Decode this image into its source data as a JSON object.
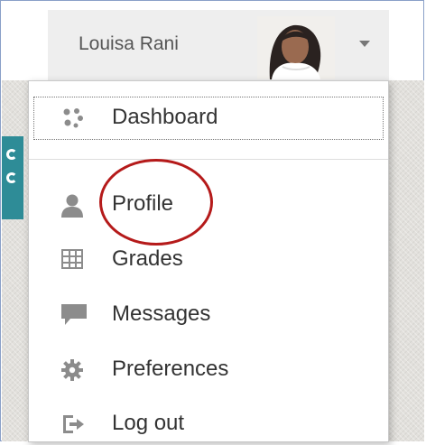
{
  "user": {
    "name": "Louisa Rani",
    "avatar_alt": "user-avatar"
  },
  "menu": {
    "items": [
      {
        "label": "Dashboard",
        "icon": "dashboard-icon"
      },
      {
        "label": "Profile",
        "icon": "user-icon"
      },
      {
        "label": "Grades",
        "icon": "grades-table-icon"
      },
      {
        "label": "Messages",
        "icon": "speech-bubble-icon"
      },
      {
        "label": "Preferences",
        "icon": "gear-icon"
      },
      {
        "label": "Log out",
        "icon": "logout-arrow-icon"
      }
    ]
  },
  "colors": {
    "menu_text": "#333333",
    "icon_gray": "#8c8c8c",
    "annotation_circle": "#b51a1a",
    "teal_strip": "#2e8c97",
    "toggle_bg": "#eeeeee"
  },
  "annotation": {
    "shape": "circle",
    "target": "Profile"
  }
}
